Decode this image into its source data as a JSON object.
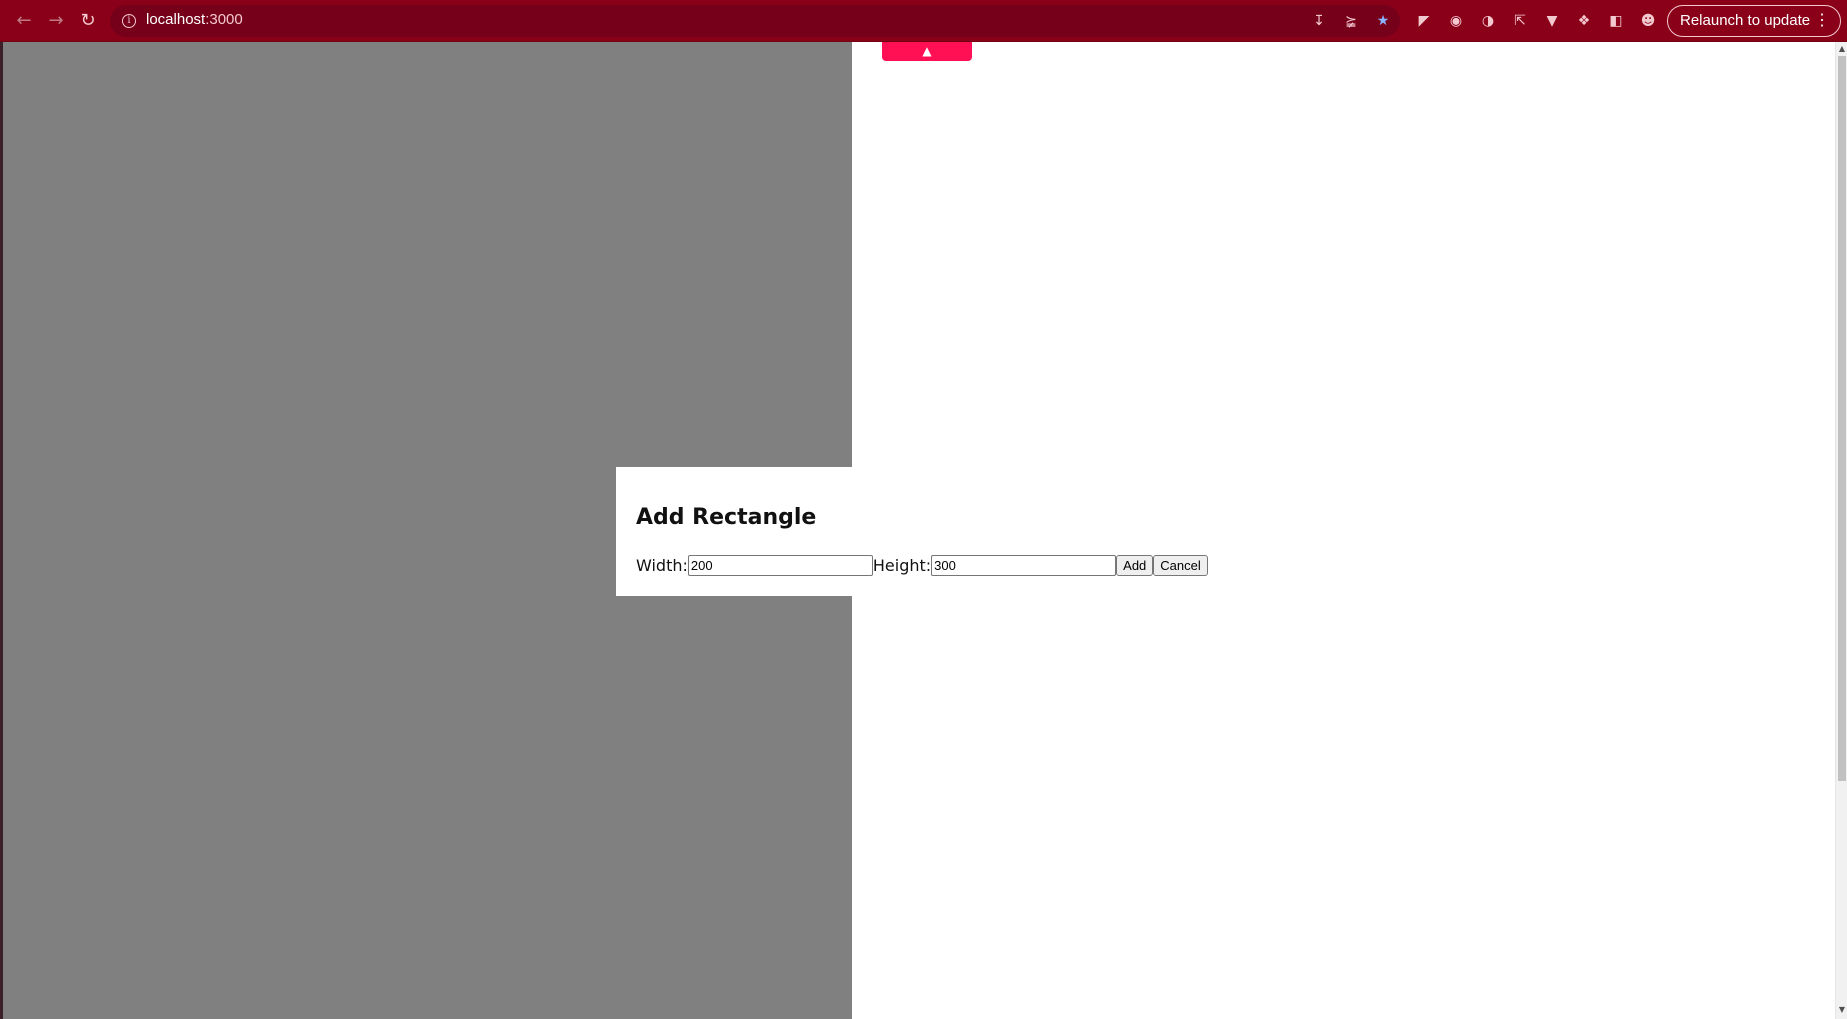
{
  "browser": {
    "url_host": "localhost",
    "url_port": ":3000",
    "relaunch_label": "Relaunch to update"
  },
  "dialog": {
    "title": "Add Rectangle",
    "width_label": "Width:",
    "width_value": "200",
    "height_label": "Height:",
    "height_value": "300",
    "add_label": "Add",
    "cancel_label": "Cancel"
  },
  "colors": {
    "chrome": "#8b0019",
    "accent_tab": "#ff1055",
    "panel": "#808080"
  }
}
